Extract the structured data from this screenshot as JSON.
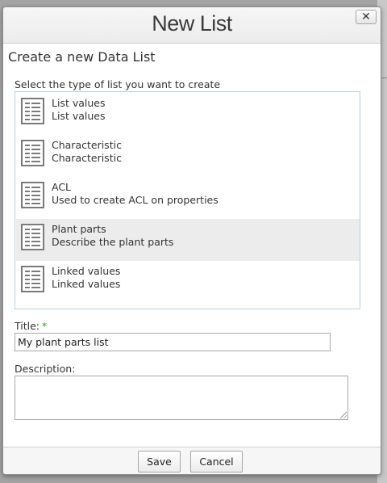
{
  "dialog": {
    "title": "New List",
    "close_label": "✕",
    "heading": "Create a new Data List",
    "type_prompt": "Select the type of list you want to create"
  },
  "list_types": [
    {
      "name": "List values",
      "description": "List values",
      "selected": false
    },
    {
      "name": "Characteristic",
      "description": "Characteristic",
      "selected": false
    },
    {
      "name": "ACL",
      "description": "Used to create ACL on properties",
      "selected": false
    },
    {
      "name": "Plant parts",
      "description": "Describe the plant parts",
      "selected": true
    },
    {
      "name": "Linked values",
      "description": "Linked values",
      "selected": false
    }
  ],
  "icons": {
    "list_type": "list-icon",
    "close": "close-icon",
    "resize": "resize-grip-icon"
  },
  "form": {
    "title_label": "Title:",
    "required_marker": "*",
    "title_value": "My plant parts list",
    "description_label": "Description:",
    "description_value": ""
  },
  "footer": {
    "save_label": "Save",
    "cancel_label": "Cancel"
  },
  "colors": {
    "required": "#2c9a2c",
    "list_border": "#b9cfe0",
    "selected_row": "#ececec"
  }
}
